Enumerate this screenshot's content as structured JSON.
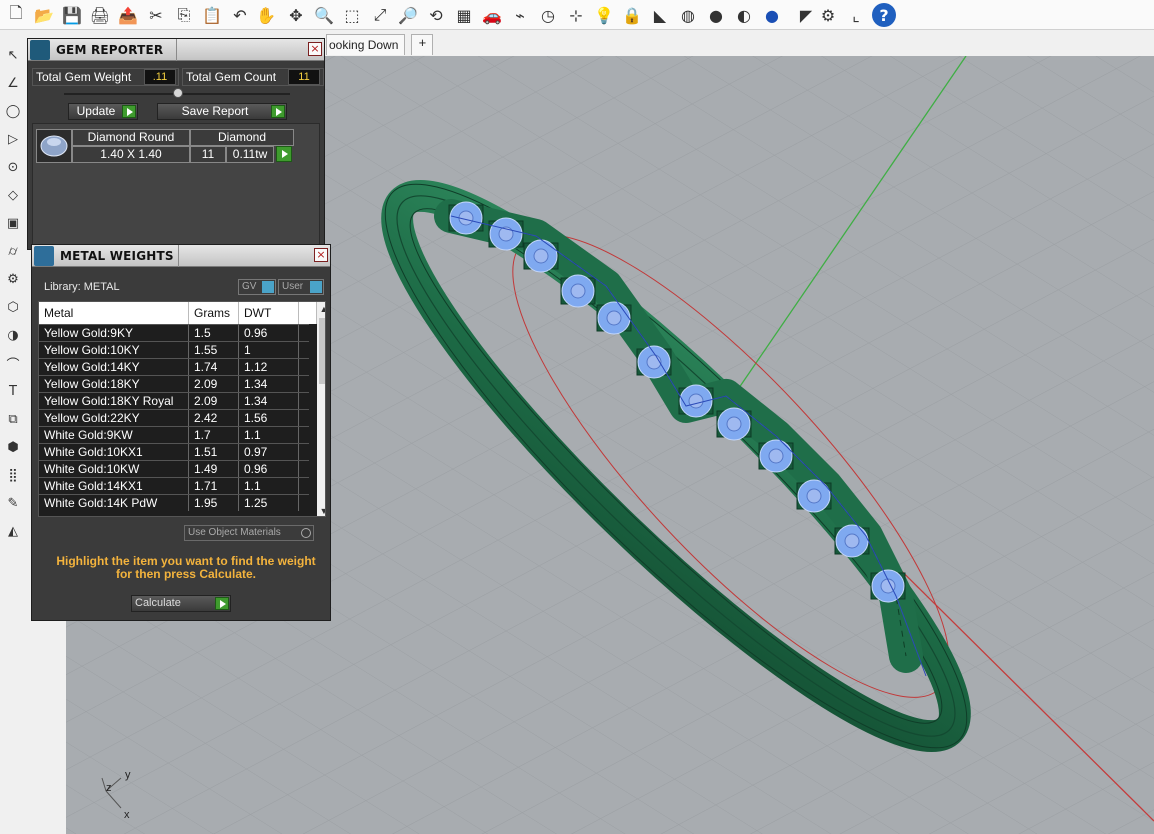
{
  "toolbar": {
    "icons": [
      "new-file",
      "open-folder",
      "save",
      "print",
      "export",
      "cut",
      "copy",
      "paste",
      "undo",
      "pan",
      "move",
      "zoom",
      "zoom-window",
      "zoom-extents",
      "zoom-selected",
      "rotate",
      "grid-layout",
      "car",
      "disconnect",
      "clock",
      "snap",
      "light",
      "lock",
      "render-material",
      "color-wheel",
      "shade-sphere",
      "gray-sphere",
      "blue-sphere",
      "pick",
      "settings",
      "crop",
      "help"
    ],
    "glyphs": [
      "🗋",
      "📂",
      "💾",
      "🖨",
      "📤",
      "✂",
      "⎘",
      "📋",
      "↶",
      "✋",
      "✥",
      "🔍",
      "⬚",
      "⤢",
      "🔎",
      "⟲",
      "▦",
      "🚗",
      "⌁",
      "◷",
      "⊹",
      "💡",
      "🔒",
      "◣",
      "◍",
      "●",
      "◐",
      "●",
      "◤",
      "⚙",
      "⌞",
      "?"
    ]
  },
  "lefttools": {
    "glyphs": [
      "↖",
      "∠",
      "◯",
      "▷",
      "⊙",
      "◇",
      "▣",
      "⌭",
      "⚙",
      "⬡",
      "◑",
      "⌒",
      "T",
      "⧉",
      "⬢",
      "⣿",
      "✎",
      "◭"
    ]
  },
  "viewport": {
    "tabs": [
      "ooking Down"
    ],
    "add_tab": "+",
    "axis_y": "y",
    "axis_z": "z",
    "axis_x": "x",
    "colors": {
      "background": "#a8acb0",
      "ring": "#1f6e49",
      "gem": "#7fa9f0",
      "green_axis": "#3fae44",
      "red_axis": "#c43c3c"
    }
  },
  "gem_reporter": {
    "title": "GEM REPORTER",
    "close": "×",
    "weight_label": "Total Gem Weight",
    "weight_value": ".11",
    "count_label": "Total Gem Count",
    "count_value": "11",
    "update_label": "Update",
    "save_label": "Save Report",
    "gem": {
      "shape": "Diamond Round",
      "size": "1.40 X 1.40",
      "type": "Diamond",
      "count": "11",
      "tw": "0.11tw"
    }
  },
  "metal_weights": {
    "title": "METAL WEIGHTS",
    "close": "×",
    "library_label": "Library: METAL",
    "gv_label": "GV",
    "user_label": "User",
    "columns": [
      "Metal",
      "Grams",
      "DWT"
    ],
    "rows": [
      [
        "Yellow Gold:9KY",
        "1.5",
        "0.96"
      ],
      [
        "Yellow Gold:10KY",
        "1.55",
        "1"
      ],
      [
        "Yellow Gold:14KY",
        "1.74",
        "1.12"
      ],
      [
        "Yellow Gold:18KY",
        "2.09",
        "1.34"
      ],
      [
        "Yellow Gold:18KY Royal",
        "2.09",
        "1.34"
      ],
      [
        "Yellow Gold:22KY",
        "2.42",
        "1.56"
      ],
      [
        "White Gold:9KW",
        "1.7",
        "1.1"
      ],
      [
        "White Gold:10KX1",
        "1.51",
        "0.97"
      ],
      [
        "White Gold:10KW",
        "1.49",
        "0.96"
      ],
      [
        "White Gold:14KX1",
        "1.71",
        "1.1"
      ],
      [
        "White Gold:14K PdW",
        "1.95",
        "1.25"
      ]
    ],
    "use_object_materials": "Use Object Materials",
    "hint_line1": "Highlight the item you want to find the weight",
    "hint_line2": "for then press Calculate.",
    "calculate_label": "Calculate"
  }
}
